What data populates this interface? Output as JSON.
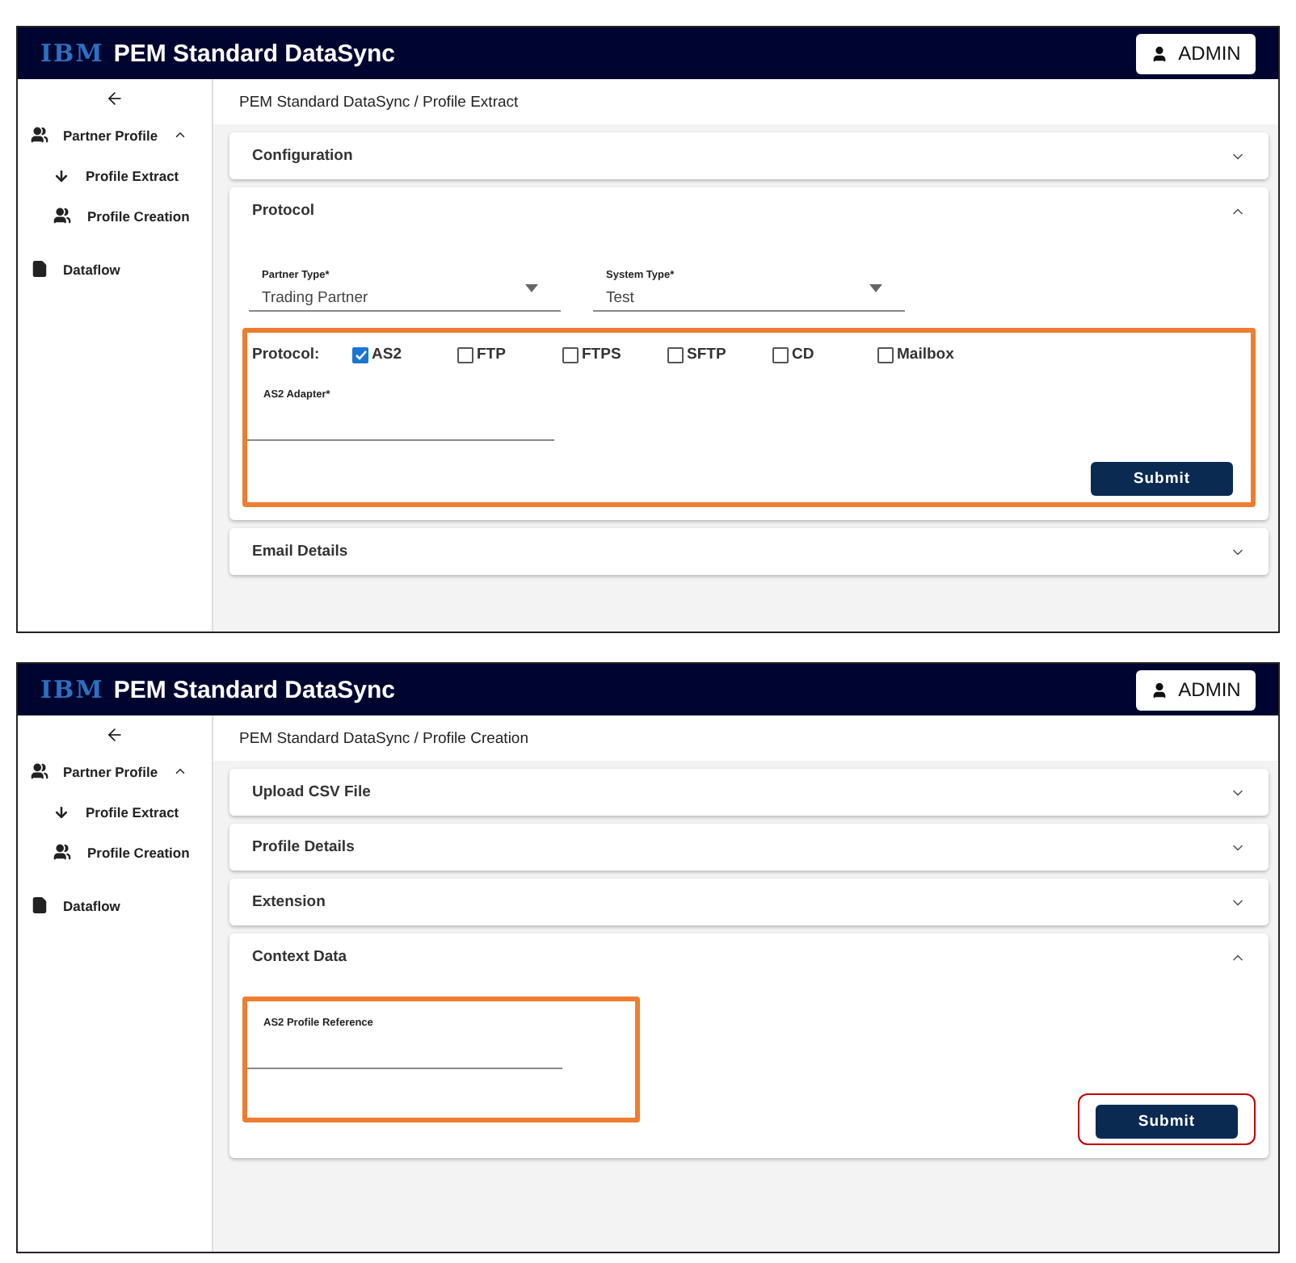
{
  "screens": [
    {
      "header": {
        "logo": "IBM",
        "title": "PEM Standard DataSync",
        "user": "ADMIN"
      },
      "sidebar": {
        "items": [
          {
            "label": "Partner Profile",
            "kind": "group",
            "expanded": true,
            "children": [
              {
                "label": "Profile Extract",
                "kind": "download"
              },
              {
                "label": "Profile Creation",
                "kind": "group"
              }
            ]
          },
          {
            "label": "Dataflow",
            "kind": "document"
          }
        ]
      },
      "breadcrumb": "PEM Standard DataSync / Profile Extract",
      "sections": [
        {
          "title": "Configuration",
          "expanded": false
        },
        {
          "title": "Protocol",
          "expanded": true,
          "selects": [
            {
              "label": "Partner Type*",
              "value": "Trading Partner"
            },
            {
              "label": "System Type*",
              "value": "Test"
            }
          ],
          "group": {
            "highlighted": true,
            "protocol": {
              "label": "Protocol:",
              "options": [
                {
                  "label": "AS2",
                  "checked": true
                },
                {
                  "label": "FTP",
                  "checked": false
                },
                {
                  "label": "FTPS",
                  "checked": false
                },
                {
                  "label": "SFTP",
                  "checked": false
                },
                {
                  "label": "CD",
                  "checked": false
                },
                {
                  "label": "Mailbox",
                  "checked": false
                }
              ]
            },
            "fields": [
              {
                "label": "AS2 Adapter*"
              }
            ],
            "submit": {
              "label": "Submit",
              "highlighted": false
            }
          }
        },
        {
          "title": "Email Details",
          "expanded": false
        }
      ]
    },
    {
      "header": {
        "logo": "IBM",
        "title": "PEM Standard DataSync",
        "user": "ADMIN"
      },
      "sidebar": {
        "items": [
          {
            "label": "Partner Profile",
            "kind": "group",
            "expanded": true,
            "children": [
              {
                "label": "Profile Extract",
                "kind": "download"
              },
              {
                "label": "Profile Creation",
                "kind": "group"
              }
            ]
          },
          {
            "label": "Dataflow",
            "kind": "document"
          }
        ]
      },
      "breadcrumb": "PEM Standard DataSync / Profile Creation",
      "sections": [
        {
          "title": "Upload CSV File",
          "expanded": false
        },
        {
          "title": "Profile Details",
          "expanded": false
        },
        {
          "title": "Extension",
          "expanded": false
        },
        {
          "title": "Context Data",
          "expanded": true,
          "group": {
            "highlighted": true,
            "fields": [
              {
                "label": "AS2 Profile Reference"
              }
            ]
          },
          "submit": {
            "label": "Submit",
            "highlighted": true
          }
        }
      ]
    }
  ]
}
